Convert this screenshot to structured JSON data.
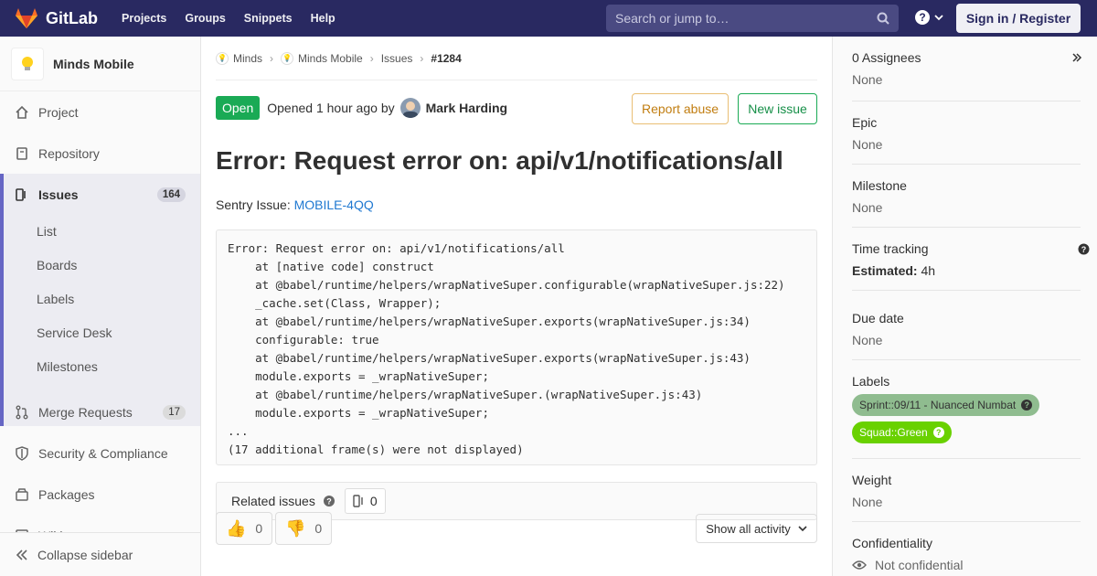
{
  "nav": {
    "brand": "GitLab",
    "links": [
      "Projects",
      "Groups",
      "Snippets",
      "Help"
    ],
    "search_placeholder": "Search or jump to…",
    "signin": "Sign in / Register"
  },
  "sidebar": {
    "project_name": "Minds Mobile",
    "items": {
      "project": "Project",
      "repository": "Repository",
      "issues": "Issues",
      "issues_count": "164",
      "merge_requests": "Merge Requests",
      "mr_count": "17",
      "security": "Security & Compliance",
      "packages": "Packages",
      "wiki": "Wiki"
    },
    "sub_items": [
      "List",
      "Boards",
      "Labels",
      "Service Desk",
      "Milestones"
    ],
    "collapse": "Collapse sidebar"
  },
  "breadcrumb": [
    "Minds",
    "Minds Mobile",
    "Issues",
    "#1284"
  ],
  "issue": {
    "status": "Open",
    "opened_prefix": "Opened",
    "opened_time": "1 hour ago",
    "opened_by": "by",
    "author": "Mark Harding",
    "report_abuse": "Report abuse",
    "new_issue": "New issue",
    "title": "Error: Request error on: api/v1/notifications/all",
    "sentry_prefix": "Sentry Issue:",
    "sentry_link": "MOBILE-4QQ",
    "code_lines": [
      "Error: Request error on: api/v1/notifications/all",
      "    at [native code] construct",
      "    at @babel/runtime/helpers/wrapNativeSuper.configurable(wrapNativeSuper.js:22)",
      "    _cache.set(Class, Wrapper);",
      "    at @babel/runtime/helpers/wrapNativeSuper.exports(wrapNativeSuper.js:34)",
      "    configurable: true",
      "    at @babel/runtime/helpers/wrapNativeSuper.exports(wrapNativeSuper.js:43)",
      "    module.exports = _wrapNativeSuper;",
      "    at @babel/runtime/helpers/wrapNativeSuper.(wrapNativeSuper.js:43)",
      "    module.exports = _wrapNativeSuper;",
      "...",
      "(17 additional frame(s) were not displayed)"
    ],
    "related_label": "Related issues",
    "related_count": "0",
    "thumbs_up": "0",
    "thumbs_down": "0",
    "activity_filter": "Show all activity"
  },
  "right_sidebar": {
    "assignees_title": "0 Assignees",
    "assignees_value": "None",
    "epic_title": "Epic",
    "epic_value": "None",
    "milestone_title": "Milestone",
    "milestone_value": "None",
    "time_title": "Time tracking",
    "estimated_label": "Estimated:",
    "estimated_value": "4h",
    "due_title": "Due date",
    "due_value": "None",
    "labels_title": "Labels",
    "labels": [
      "Sprint::09/11 - Nuanced Numbat",
      "Squad::Green"
    ],
    "weight_title": "Weight",
    "weight_value": "None",
    "confidentiality_title": "Confidentiality",
    "confidentiality_value": "Not confidential"
  },
  "colors": {
    "nav_bg": "#292961",
    "open_green": "#1aaa55",
    "label_sprint": "#8fbc8f",
    "label_squad": "#69d100",
    "link_blue": "#1f78d1"
  }
}
